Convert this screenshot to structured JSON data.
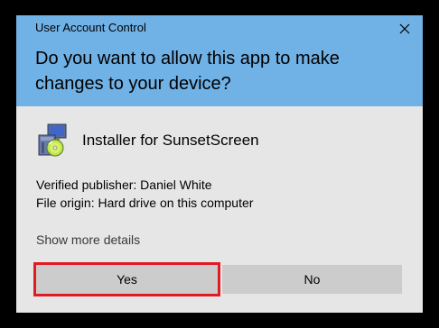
{
  "window": {
    "title": "User Account Control",
    "close_icon": "close-icon"
  },
  "prompt": {
    "question": "Do you want to allow this app to make changes to your device?"
  },
  "app": {
    "icon": "installer-package-icon",
    "name": "Installer for SunsetScreen"
  },
  "details": {
    "publisher": "Verified publisher: Daniel White",
    "origin": "File origin: Hard drive on this computer",
    "show_more": "Show more details"
  },
  "buttons": {
    "yes": "Yes",
    "no": "No"
  },
  "colors": {
    "header": "#70b1e6",
    "body": "#e6e6e6",
    "button": "#cccccc",
    "highlight": "#e01b24"
  }
}
